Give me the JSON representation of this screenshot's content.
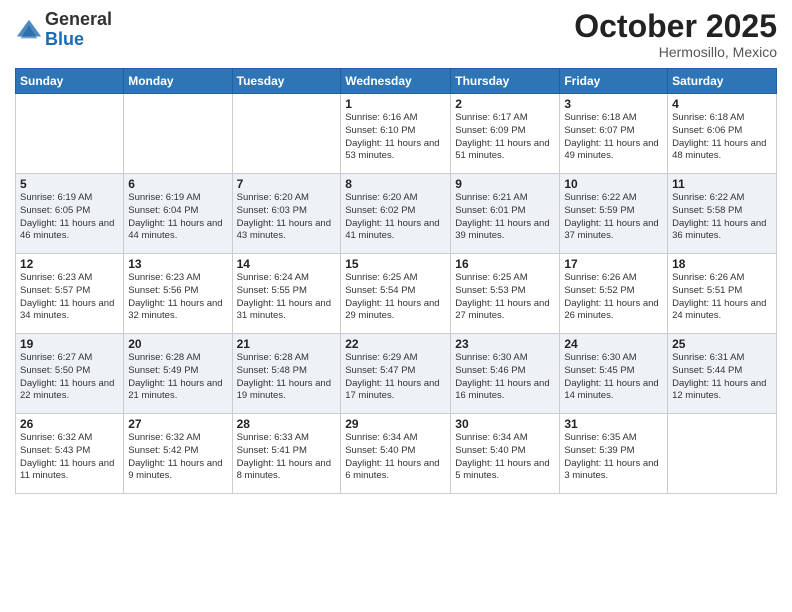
{
  "logo": {
    "general": "General",
    "blue": "Blue"
  },
  "title": "October 2025",
  "subtitle": "Hermosillo, Mexico",
  "days_header": [
    "Sunday",
    "Monday",
    "Tuesday",
    "Wednesday",
    "Thursday",
    "Friday",
    "Saturday"
  ],
  "weeks": [
    [
      {
        "num": "",
        "sunrise": "",
        "sunset": "",
        "daylight": ""
      },
      {
        "num": "",
        "sunrise": "",
        "sunset": "",
        "daylight": ""
      },
      {
        "num": "",
        "sunrise": "",
        "sunset": "",
        "daylight": ""
      },
      {
        "num": "1",
        "sunrise": "Sunrise: 6:16 AM",
        "sunset": "Sunset: 6:10 PM",
        "daylight": "Daylight: 11 hours and 53 minutes."
      },
      {
        "num": "2",
        "sunrise": "Sunrise: 6:17 AM",
        "sunset": "Sunset: 6:09 PM",
        "daylight": "Daylight: 11 hours and 51 minutes."
      },
      {
        "num": "3",
        "sunrise": "Sunrise: 6:18 AM",
        "sunset": "Sunset: 6:07 PM",
        "daylight": "Daylight: 11 hours and 49 minutes."
      },
      {
        "num": "4",
        "sunrise": "Sunrise: 6:18 AM",
        "sunset": "Sunset: 6:06 PM",
        "daylight": "Daylight: 11 hours and 48 minutes."
      }
    ],
    [
      {
        "num": "5",
        "sunrise": "Sunrise: 6:19 AM",
        "sunset": "Sunset: 6:05 PM",
        "daylight": "Daylight: 11 hours and 46 minutes."
      },
      {
        "num": "6",
        "sunrise": "Sunrise: 6:19 AM",
        "sunset": "Sunset: 6:04 PM",
        "daylight": "Daylight: 11 hours and 44 minutes."
      },
      {
        "num": "7",
        "sunrise": "Sunrise: 6:20 AM",
        "sunset": "Sunset: 6:03 PM",
        "daylight": "Daylight: 11 hours and 43 minutes."
      },
      {
        "num": "8",
        "sunrise": "Sunrise: 6:20 AM",
        "sunset": "Sunset: 6:02 PM",
        "daylight": "Daylight: 11 hours and 41 minutes."
      },
      {
        "num": "9",
        "sunrise": "Sunrise: 6:21 AM",
        "sunset": "Sunset: 6:01 PM",
        "daylight": "Daylight: 11 hours and 39 minutes."
      },
      {
        "num": "10",
        "sunrise": "Sunrise: 6:22 AM",
        "sunset": "Sunset: 5:59 PM",
        "daylight": "Daylight: 11 hours and 37 minutes."
      },
      {
        "num": "11",
        "sunrise": "Sunrise: 6:22 AM",
        "sunset": "Sunset: 5:58 PM",
        "daylight": "Daylight: 11 hours and 36 minutes."
      }
    ],
    [
      {
        "num": "12",
        "sunrise": "Sunrise: 6:23 AM",
        "sunset": "Sunset: 5:57 PM",
        "daylight": "Daylight: 11 hours and 34 minutes."
      },
      {
        "num": "13",
        "sunrise": "Sunrise: 6:23 AM",
        "sunset": "Sunset: 5:56 PM",
        "daylight": "Daylight: 11 hours and 32 minutes."
      },
      {
        "num": "14",
        "sunrise": "Sunrise: 6:24 AM",
        "sunset": "Sunset: 5:55 PM",
        "daylight": "Daylight: 11 hours and 31 minutes."
      },
      {
        "num": "15",
        "sunrise": "Sunrise: 6:25 AM",
        "sunset": "Sunset: 5:54 PM",
        "daylight": "Daylight: 11 hours and 29 minutes."
      },
      {
        "num": "16",
        "sunrise": "Sunrise: 6:25 AM",
        "sunset": "Sunset: 5:53 PM",
        "daylight": "Daylight: 11 hours and 27 minutes."
      },
      {
        "num": "17",
        "sunrise": "Sunrise: 6:26 AM",
        "sunset": "Sunset: 5:52 PM",
        "daylight": "Daylight: 11 hours and 26 minutes."
      },
      {
        "num": "18",
        "sunrise": "Sunrise: 6:26 AM",
        "sunset": "Sunset: 5:51 PM",
        "daylight": "Daylight: 11 hours and 24 minutes."
      }
    ],
    [
      {
        "num": "19",
        "sunrise": "Sunrise: 6:27 AM",
        "sunset": "Sunset: 5:50 PM",
        "daylight": "Daylight: 11 hours and 22 minutes."
      },
      {
        "num": "20",
        "sunrise": "Sunrise: 6:28 AM",
        "sunset": "Sunset: 5:49 PM",
        "daylight": "Daylight: 11 hours and 21 minutes."
      },
      {
        "num": "21",
        "sunrise": "Sunrise: 6:28 AM",
        "sunset": "Sunset: 5:48 PM",
        "daylight": "Daylight: 11 hours and 19 minutes."
      },
      {
        "num": "22",
        "sunrise": "Sunrise: 6:29 AM",
        "sunset": "Sunset: 5:47 PM",
        "daylight": "Daylight: 11 hours and 17 minutes."
      },
      {
        "num": "23",
        "sunrise": "Sunrise: 6:30 AM",
        "sunset": "Sunset: 5:46 PM",
        "daylight": "Daylight: 11 hours and 16 minutes."
      },
      {
        "num": "24",
        "sunrise": "Sunrise: 6:30 AM",
        "sunset": "Sunset: 5:45 PM",
        "daylight": "Daylight: 11 hours and 14 minutes."
      },
      {
        "num": "25",
        "sunrise": "Sunrise: 6:31 AM",
        "sunset": "Sunset: 5:44 PM",
        "daylight": "Daylight: 11 hours and 12 minutes."
      }
    ],
    [
      {
        "num": "26",
        "sunrise": "Sunrise: 6:32 AM",
        "sunset": "Sunset: 5:43 PM",
        "daylight": "Daylight: 11 hours and 11 minutes."
      },
      {
        "num": "27",
        "sunrise": "Sunrise: 6:32 AM",
        "sunset": "Sunset: 5:42 PM",
        "daylight": "Daylight: 11 hours and 9 minutes."
      },
      {
        "num": "28",
        "sunrise": "Sunrise: 6:33 AM",
        "sunset": "Sunset: 5:41 PM",
        "daylight": "Daylight: 11 hours and 8 minutes."
      },
      {
        "num": "29",
        "sunrise": "Sunrise: 6:34 AM",
        "sunset": "Sunset: 5:40 PM",
        "daylight": "Daylight: 11 hours and 6 minutes."
      },
      {
        "num": "30",
        "sunrise": "Sunrise: 6:34 AM",
        "sunset": "Sunset: 5:40 PM",
        "daylight": "Daylight: 11 hours and 5 minutes."
      },
      {
        "num": "31",
        "sunrise": "Sunrise: 6:35 AM",
        "sunset": "Sunset: 5:39 PM",
        "daylight": "Daylight: 11 hours and 3 minutes."
      },
      {
        "num": "",
        "sunrise": "",
        "sunset": "",
        "daylight": ""
      }
    ]
  ]
}
